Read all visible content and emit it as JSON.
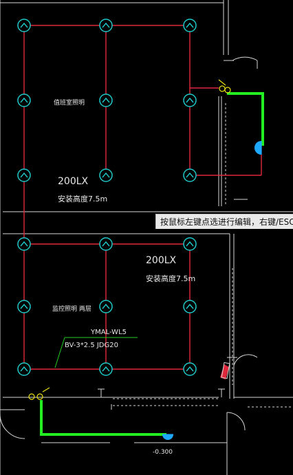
{
  "colors": {
    "background": "#000000",
    "wall": "#d9d9d9",
    "wire": "#e0283c",
    "fixture": "#1fc8c8",
    "feed": "#22ee22",
    "accent": "#1fa8ff",
    "label": "#e8e8e8"
  },
  "annotations": {
    "room1_name": "值班室照明",
    "room1_lux": "200LX",
    "room1_height": "安装高度7.5m",
    "room2_lux": "200LX",
    "room2_height": "安装高度7.5m",
    "room2_name": "监控照明 两层",
    "circuit": "YMAL-WL5",
    "cable": "BV-3*2.5 JDG20",
    "elevation": "-0.300"
  },
  "tooltip": {
    "text": "按鼠标左键点选进行编辑，右键/ESC"
  },
  "icons": {
    "fixture": "pendant-light-icon",
    "box": "junction-box-icon",
    "outlet": "outlet-icon",
    "panel": "distribution-panel-icon"
  }
}
